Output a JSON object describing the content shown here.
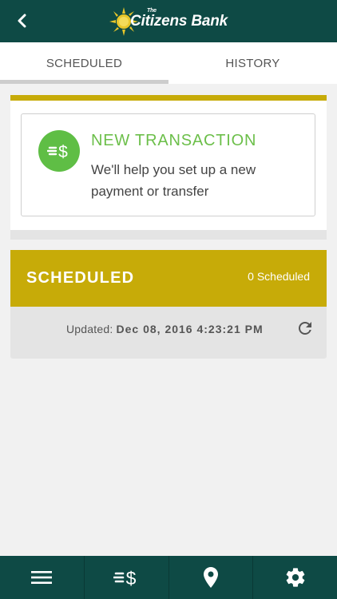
{
  "header": {
    "logo_small": "The",
    "logo_text": "Citizens Bank",
    "back_icon": "chevron-left-icon"
  },
  "tabs": [
    {
      "label": "SCHEDULED",
      "active": true
    },
    {
      "label": "HISTORY",
      "active": false
    }
  ],
  "new_transaction": {
    "icon": "transfer-money-icon",
    "title": "NEW TRANSACTION",
    "description": "We'll help you set up a new payment or transfer"
  },
  "scheduled": {
    "title": "SCHEDULED",
    "count_text": "0 Scheduled",
    "updated_label": "Updated: ",
    "updated_value": "Dec 08, 2016 4:23:21 PM",
    "refresh_icon": "refresh-icon"
  },
  "bottom_nav": [
    {
      "icon": "menu-icon"
    },
    {
      "icon": "transfer-money-icon"
    },
    {
      "icon": "location-pin-icon"
    },
    {
      "icon": "gear-icon"
    }
  ],
  "colors": {
    "header_bg": "#0e4a45",
    "accent_gold": "#c7ab08",
    "accent_green": "#5fbe45",
    "background": "#f1f1f1"
  }
}
